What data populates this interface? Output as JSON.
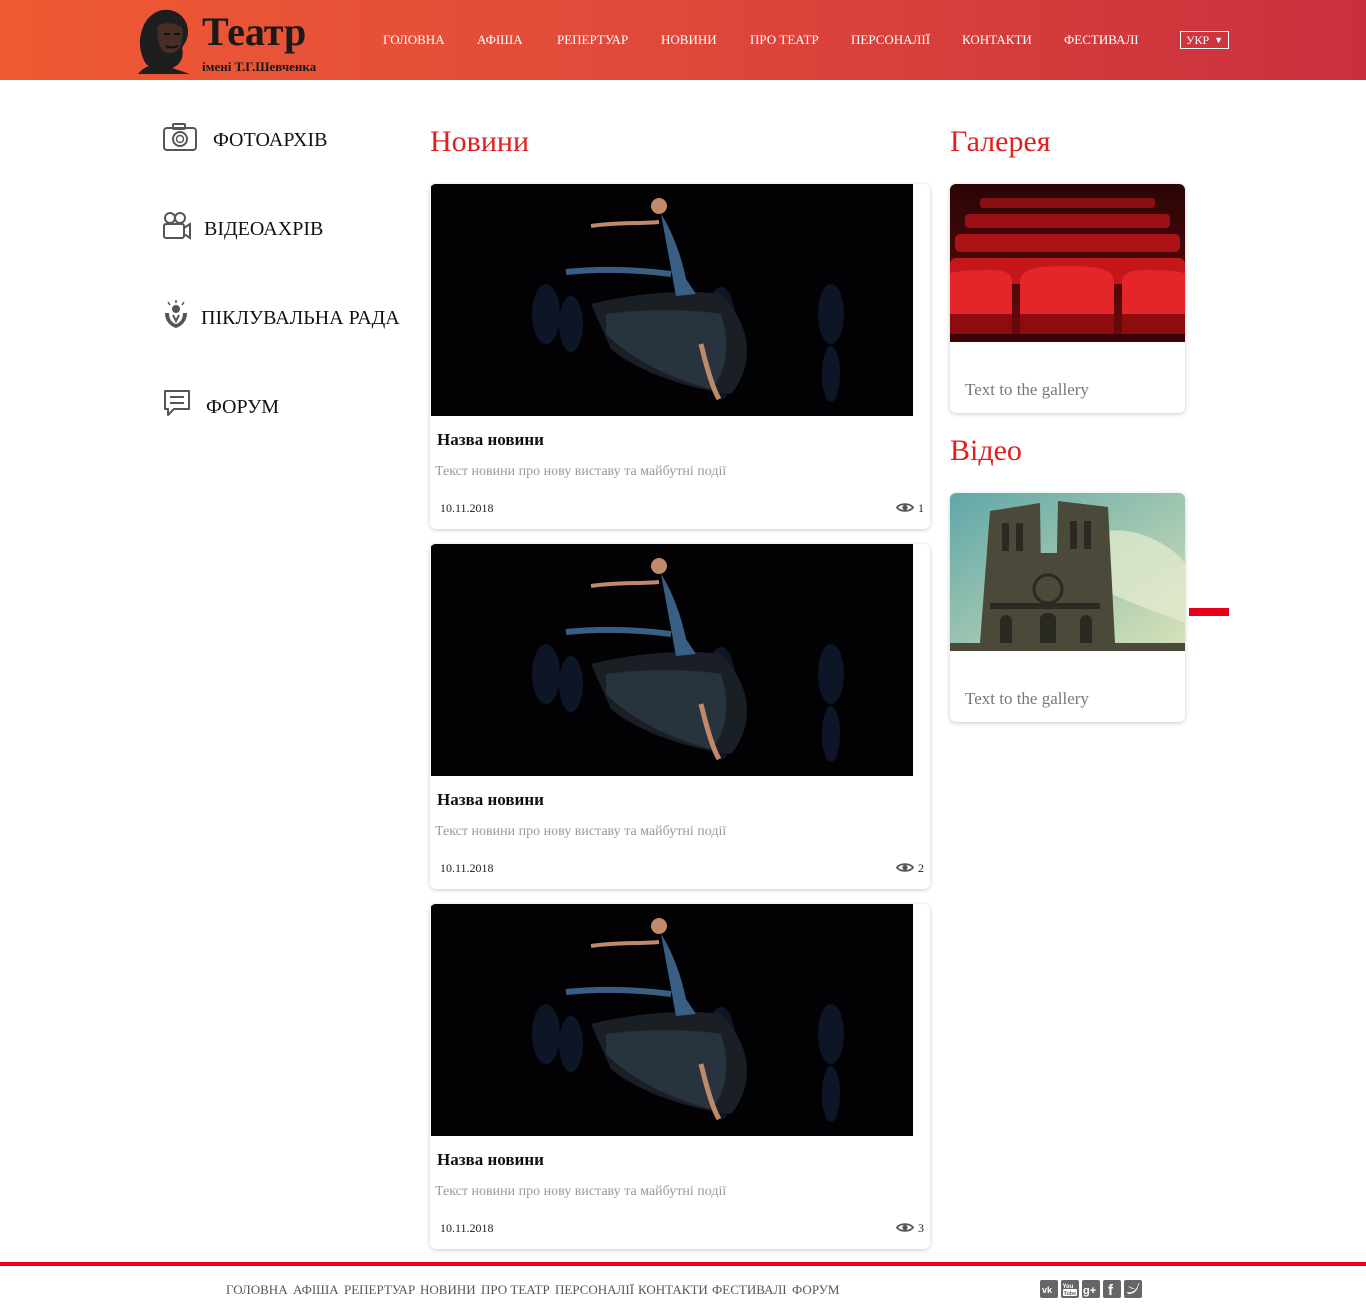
{
  "header": {
    "logo_title": "Театр",
    "logo_subtitle": "імені Т.Г.Шевченка",
    "nav": [
      "ГОЛОВНА",
      "АФІША",
      "РЕПЕРТУАР",
      "НОВИНИ",
      "ПРО ТЕАТР",
      "ПЕРСОНАЛІЇ",
      "КОНТАКТИ",
      "ФЕСТИВАЛІ"
    ],
    "language": "УКР"
  },
  "sidebar": {
    "items": [
      {
        "label": "ФОТОАРХІВ",
        "icon": "camera-icon"
      },
      {
        "label": "ВІДЕОАХРІВ",
        "icon": "video-camera-icon"
      },
      {
        "label": "ПІКЛУВАЛЬНА РАДА",
        "icon": "care-hands-icon"
      },
      {
        "label": "ФОРУМ",
        "icon": "chat-icon"
      }
    ]
  },
  "news": {
    "title": "Новини",
    "items": [
      {
        "title": "Назва новини",
        "text": "Текст новини про нову виставу та майбутні події",
        "date": "10.11.2018",
        "views": "1"
      },
      {
        "title": "Назва новини",
        "text": "Текст новини про нову виставу та майбутні події",
        "date": "10.11.2018",
        "views": "2"
      },
      {
        "title": "Назва новини",
        "text": "Текст новини про нову виставу та майбутні події",
        "date": "10.11.2018",
        "views": "3"
      }
    ]
  },
  "gallery": {
    "title": "Галерея",
    "caption": "Text to the gallery"
  },
  "video": {
    "title": "Відео",
    "caption": "Text to the gallery"
  },
  "footer": {
    "nav": [
      "ГОЛОВНА",
      "АФІША",
      "РЕПЕРТУАР",
      "НОВИНИ",
      "ПРО ТЕАТР",
      "ПЕРСОНАЛІЇ",
      "КОНТАКТИ",
      "ФЕСТИВАЛІ",
      "ФОРУМ"
    ],
    "social": [
      "vk-icon",
      "youtube-icon",
      "google-plus-icon",
      "facebook-icon",
      "twitter-icon"
    ]
  },
  "colors": {
    "accent_red": "#e31e1e",
    "header_gradient_start": "#ef5a33",
    "header_gradient_end": "#c92f3d"
  }
}
